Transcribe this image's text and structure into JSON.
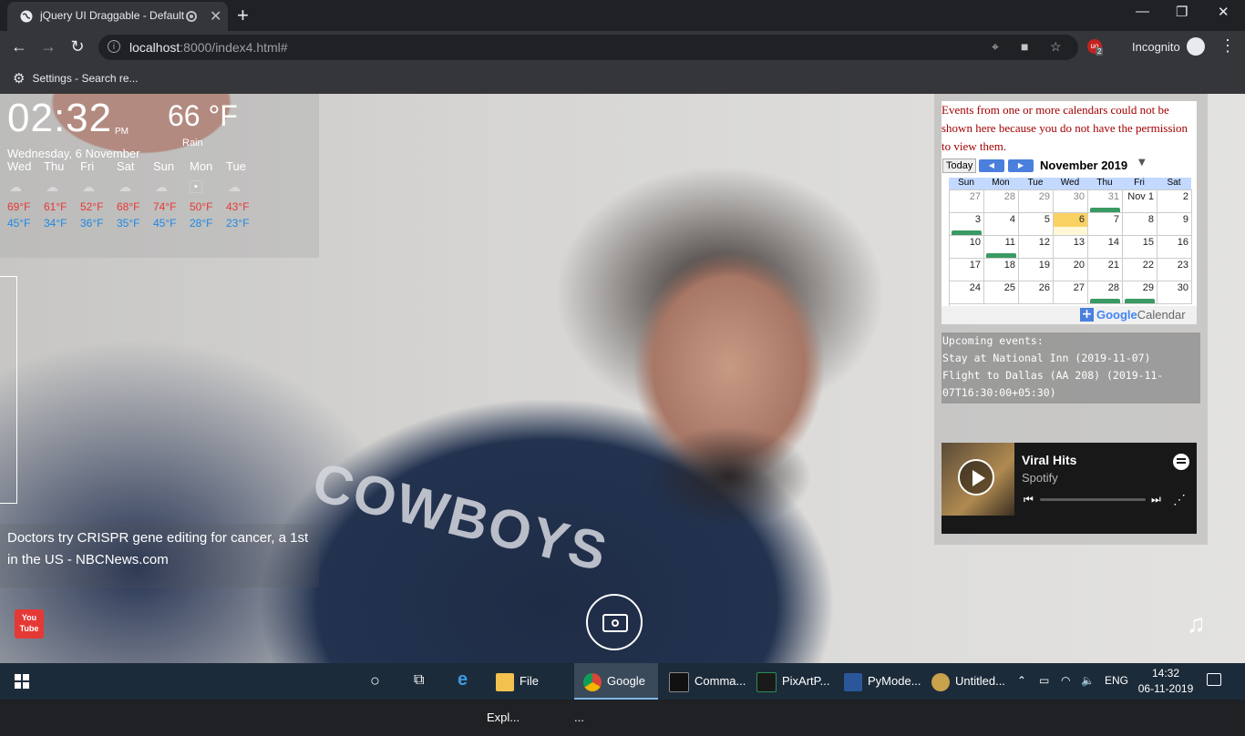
{
  "browser": {
    "tab_title": "jQuery UI Draggable - Default",
    "tab_close": "✕",
    "new_tab": "+",
    "url_host": "localhost",
    "url_rest": ":8000/index4.html#",
    "incognito_label": "Incognito",
    "extension_count": "2",
    "bookmark_label": "Settings - Search re..."
  },
  "weather": {
    "time": "02:32",
    "ampm": "PM",
    "temperature": "66 °F",
    "condition": "Rain",
    "date": "Wednesday, 6 November",
    "forecast": [
      {
        "day": "Wed",
        "high": "69°F",
        "low": "45°F",
        "icon": "cloud-icon"
      },
      {
        "day": "Thu",
        "high": "61°F",
        "low": "34°F",
        "icon": "cloud-icon"
      },
      {
        "day": "Fri",
        "high": "52°F",
        "low": "36°F",
        "icon": "cloud-icon"
      },
      {
        "day": "Sat",
        "high": "68°F",
        "low": "35°F",
        "icon": "cloud-icon"
      },
      {
        "day": "Sun",
        "high": "74°F",
        "low": "45°F",
        "icon": "cloud-icon"
      },
      {
        "day": "Mon",
        "high": "50°F",
        "low": "28°F",
        "icon": "broken-image-icon"
      },
      {
        "day": "Tue",
        "high": "43°F",
        "low": "23°F",
        "icon": "cloud-icon"
      }
    ]
  },
  "news": {
    "headline": "Doctors try CRISPR gene editing for cancer, a 1st in the US - NBCNews.com"
  },
  "youtube": {
    "label": "You Tube"
  },
  "calendar": {
    "error": "Events from one or more calendars could not be shown here because you do not have the permission to view them.",
    "today_button": "Today",
    "month": "November 2019",
    "weekdays": [
      "Sun",
      "Mon",
      "Tue",
      "Wed",
      "Thu",
      "Fri",
      "Sat"
    ],
    "weeks": [
      [
        "27",
        "28",
        "29",
        "30",
        "31",
        "Nov 1",
        "2"
      ],
      [
        "3",
        "4",
        "5",
        "6",
        "7",
        "8",
        "9"
      ],
      [
        "10",
        "11",
        "12",
        "13",
        "14",
        "15",
        "16"
      ],
      [
        "17",
        "18",
        "19",
        "20",
        "21",
        "22",
        "23"
      ],
      [
        "24",
        "25",
        "26",
        "27",
        "28",
        "29",
        "30"
      ]
    ],
    "footer_google": "Google",
    "footer_calendar": "Calendar"
  },
  "upcoming": {
    "heading": "Upcoming events:",
    "events": [
      "Stay at National Inn (2019-11-07)",
      "Flight to Dallas (AA 208) (2019-11-07T16:30:00+05:30)"
    ]
  },
  "spotify": {
    "title": "Viral Hits",
    "subtitle": "Spotify"
  },
  "taskbar": {
    "apps": [
      {
        "label": "File Expl...",
        "color": "#f2c14e"
      },
      {
        "label": "Google ...",
        "color": "#4285f4"
      },
      {
        "label": "Comma...",
        "color": "#111111"
      },
      {
        "label": "PixArtP...",
        "color": "#2e8b57"
      },
      {
        "label": "PyMode...",
        "color": "#2b579a"
      },
      {
        "label": "Untitled...",
        "color": "#c9a24b"
      }
    ],
    "language": "ENG",
    "time": "14:32",
    "date": "06-11-2019"
  }
}
